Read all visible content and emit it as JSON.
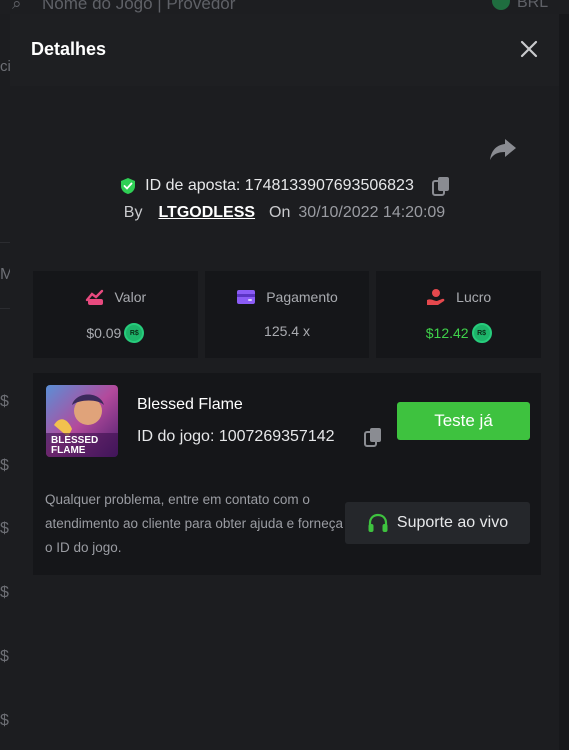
{
  "background": {
    "search_placeholder": "Nome do Jogo | Provedor",
    "currency": "BRL",
    "left_chars": [
      "M",
      "$",
      "$",
      "$",
      "$",
      "$",
      "$",
      "$"
    ]
  },
  "modal": {
    "title": "Detalhes",
    "bet_label": "ID de aposta: 1748133907693506823",
    "by_label": "By",
    "username": "LTGODLESS",
    "on_label": "On",
    "date": "30/10/2022 14:20:09"
  },
  "stats": [
    {
      "label": "Valor",
      "value": "$0.09",
      "icon": "wager-icon",
      "coin": "R$"
    },
    {
      "label": "Pagamento",
      "value": "125.4 x",
      "icon": "wallet-icon"
    },
    {
      "label": "Lucro",
      "value": "$12.42",
      "icon": "profit-icon",
      "coin": "R$"
    }
  ],
  "game": {
    "name": "Blessed Flame",
    "id_label": "ID do jogo: 1007269357142",
    "thumb_text_1": "BLESSED",
    "thumb_text_2": "FLAME",
    "try_label": "Teste já",
    "help_text": "Qualquer problema, entre em contato com o atendimento ao cliente para obter ajuda e forneça o ID do jogo.",
    "support_label": "Suporte ao vivo"
  },
  "colors": {
    "accent_green": "#3ec23f",
    "shield_green": "#2fcf55",
    "profit_green": "#3fd14a",
    "wager_pink": "#e84a7f",
    "wallet_purple": "#8b5cf6",
    "profit_red": "#e5484d"
  }
}
